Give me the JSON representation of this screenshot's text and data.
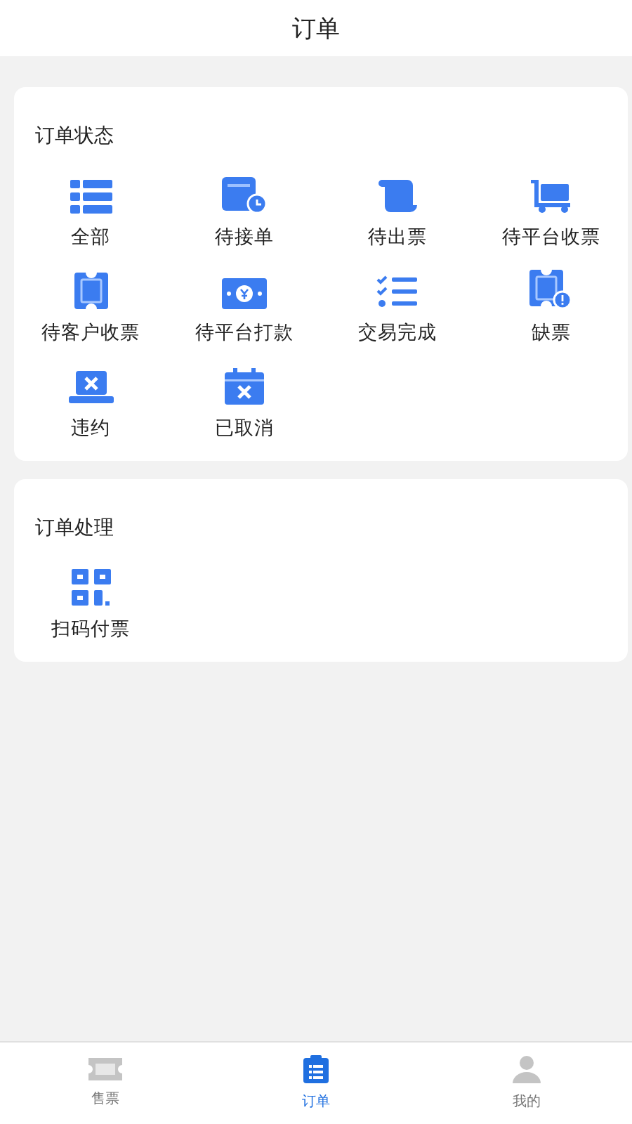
{
  "header": {
    "title": "订单"
  },
  "sections": [
    {
      "title": "订单状态",
      "items": [
        {
          "label": "全部",
          "kind": "list"
        },
        {
          "label": "待接单",
          "kind": "clock"
        },
        {
          "label": "待出票",
          "kind": "scroll"
        },
        {
          "label": "待平台收票",
          "kind": "cart"
        },
        {
          "label": "待客户收票",
          "kind": "ticket"
        },
        {
          "label": "待平台打款",
          "kind": "money"
        },
        {
          "label": "交易完成",
          "kind": "checklist"
        },
        {
          "label": "缺票",
          "kind": "alert"
        },
        {
          "label": "违约",
          "kind": "laptop-x"
        },
        {
          "label": "已取消",
          "kind": "calendar-x"
        }
      ]
    },
    {
      "title": "订单处理",
      "items": [
        {
          "label": "扫码付票",
          "kind": "qr"
        }
      ]
    }
  ],
  "tabs": [
    {
      "label": "售票",
      "kind": "ticket",
      "selected": false
    },
    {
      "label": "订单",
      "kind": "clipboard",
      "selected": true
    },
    {
      "label": "我的",
      "kind": "person",
      "selected": false
    }
  ]
}
